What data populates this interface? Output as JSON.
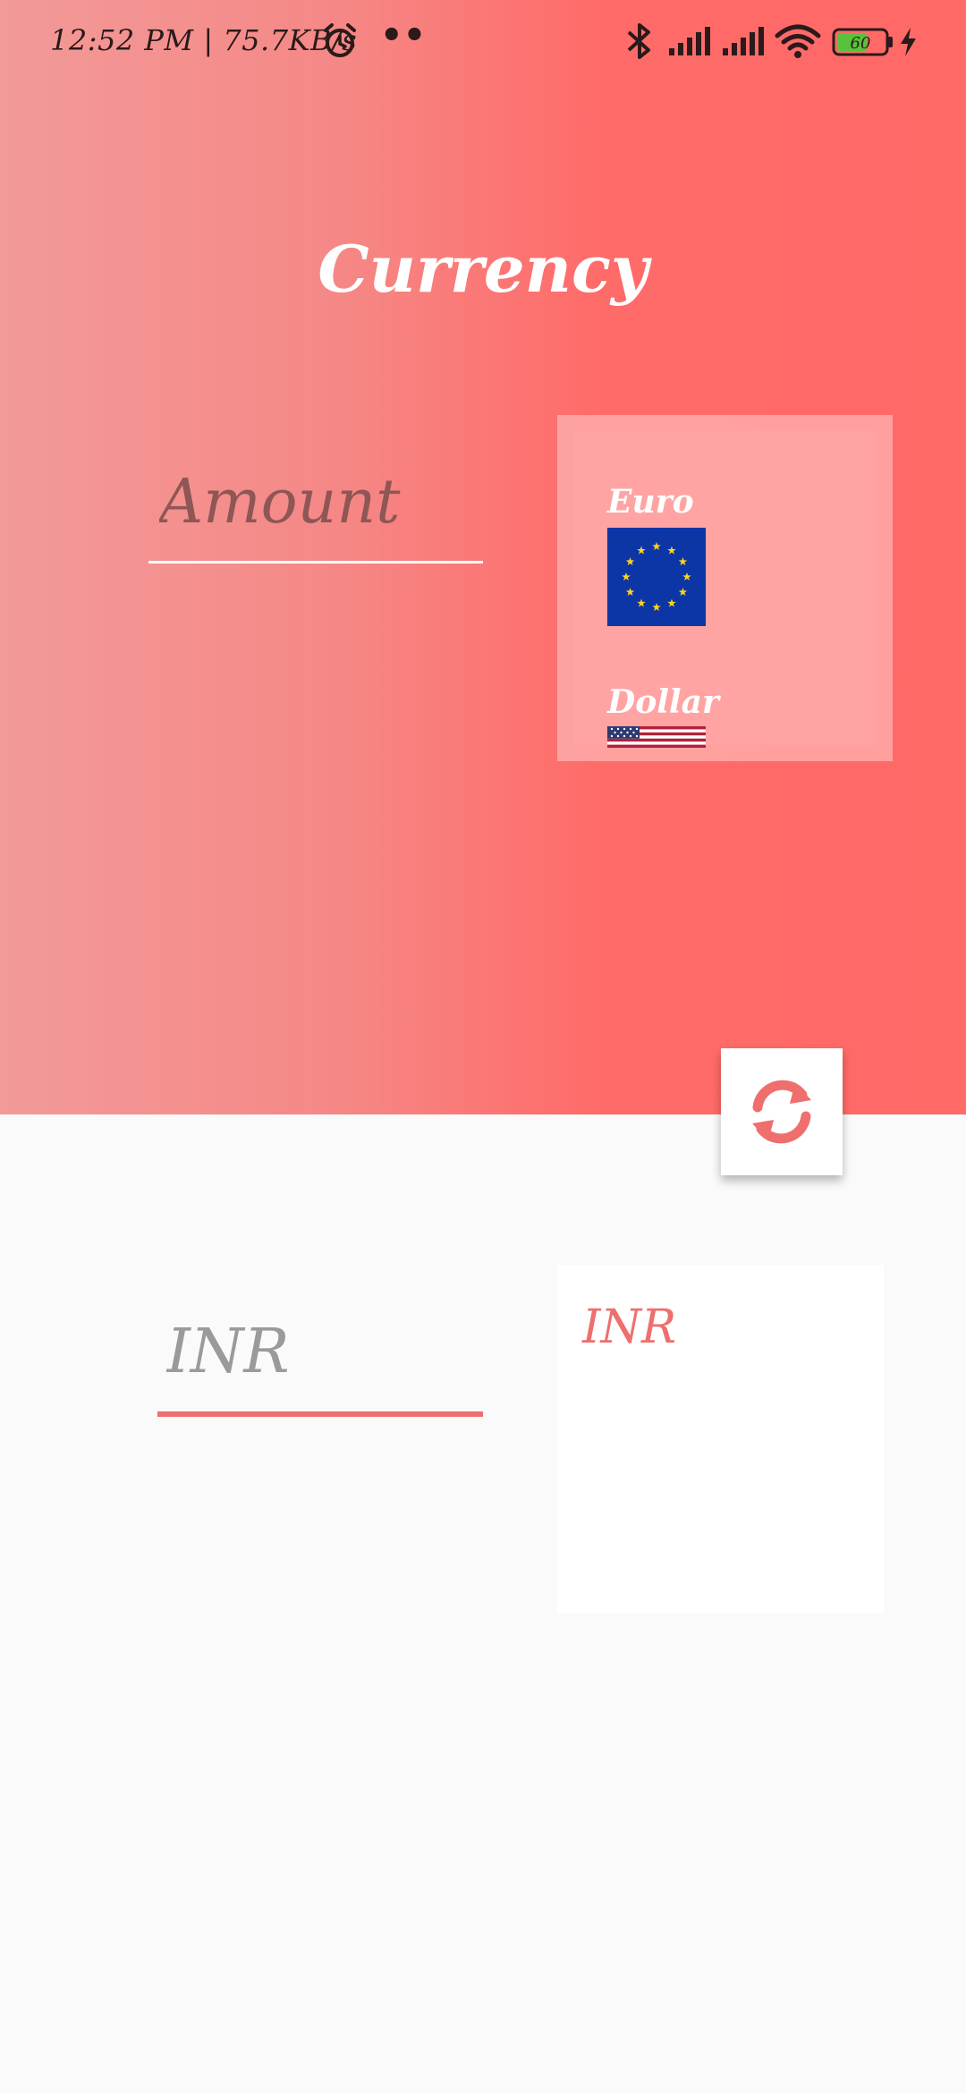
{
  "status_bar": {
    "time": "12:52 PM | 75.7KB/s",
    "dots": "••",
    "battery_level": "60",
    "icons": [
      "alarm-icon",
      "bluetooth-icon",
      "signal-icon",
      "signal-icon",
      "wifi-icon",
      "battery-icon",
      "charging-icon"
    ]
  },
  "header": {
    "title": "Currency"
  },
  "amount": {
    "placeholder": "Amount"
  },
  "from_currencies": {
    "items": [
      {
        "label": "Euro",
        "flag": "eu-flag-icon"
      },
      {
        "label": "Dollar",
        "flag": "us-flag-icon"
      }
    ]
  },
  "swap": {
    "icon": "refresh-icon"
  },
  "result": {
    "placeholder": "INR"
  },
  "to_currencies": {
    "items": [
      {
        "label": "INR"
      }
    ]
  },
  "colors": {
    "accent": "#ee6f6d",
    "gradient_start": "#f29a98",
    "gradient_end": "#ff6a67",
    "list_bg": "#ffa4a3",
    "page_bg": "#fafafa"
  }
}
